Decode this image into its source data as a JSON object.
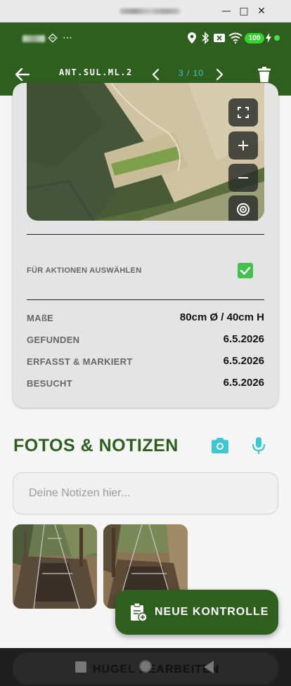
{
  "window": {
    "minimize_glyph": "—",
    "maximize_glyph": "□",
    "close_glyph": "✕"
  },
  "status_bar": {
    "more_glyph": "⋯",
    "battery": "100",
    "icons": [
      "location-icon",
      "bluetooth-icon",
      "no-sim-icon",
      "wifi-icon",
      "battery-icon",
      "charging-icon"
    ]
  },
  "app_bar": {
    "title": "ANT.SUL.ML.2",
    "pager": "3 / 10",
    "icons": [
      "back-arrow-icon",
      "chevron-left-icon",
      "chevron-right-icon",
      "trash-icon"
    ]
  },
  "map": {
    "controls": [
      "fullscreen-icon",
      "zoom-in-icon",
      "zoom-out-icon",
      "locate-icon"
    ]
  },
  "details": {
    "select_label": "FÜR AKTIONEN AUSWÄHLEN",
    "select_checked": true,
    "rows": [
      {
        "label": "MAßE",
        "value": "80cm Ø / 40cm H"
      },
      {
        "label": "GEFUNDEN",
        "value": "6.5.2026"
      },
      {
        "label": "ERFASST & MARKIERT",
        "value": "6.5.2026"
      },
      {
        "label": "BESUCHT",
        "value": "6.5.2026"
      }
    ]
  },
  "photos_notes": {
    "title": "FOTOS & NOTIZEN",
    "notes_placeholder": "Deine Notizen hier...",
    "icons": [
      "camera-icon",
      "microphone-icon"
    ],
    "photo_count": 2
  },
  "fab": {
    "label": "NEUE KONTROLLE"
  },
  "bottom_bar": {
    "label": "HÜGEL BEARBEITEN"
  },
  "colors": {
    "primary": "#2e5f1f",
    "accent": "#3ec6d2",
    "checkbox": "#44c050",
    "battery": "#35d22f"
  }
}
